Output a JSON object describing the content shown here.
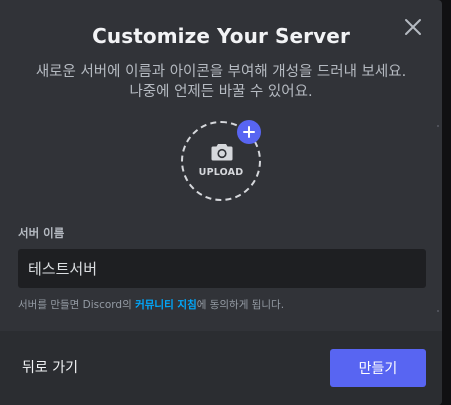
{
  "modal": {
    "title": "Customize Your Server",
    "subtitle": "새로운 서버에 이름과 아이콘을 부여해 개성을 드러내 보세요. 나중에 언제든 바꿀 수 있어요.",
    "close_icon": "close-icon"
  },
  "upload": {
    "label": "UPLOAD",
    "camera_icon": "camera-icon",
    "plus_icon": "plus-icon",
    "accent": "#5865f2"
  },
  "server_name": {
    "label": "서버 이름",
    "value": "테스트서버"
  },
  "terms": {
    "prefix": "서버를 만들면 Discord의 ",
    "link": "커뮤니티 지침",
    "suffix": "에 동의하게 됩니다.",
    "link_color": "#00a8fc"
  },
  "footer": {
    "back_label": "뒤로 가기",
    "create_label": "만들기"
  }
}
